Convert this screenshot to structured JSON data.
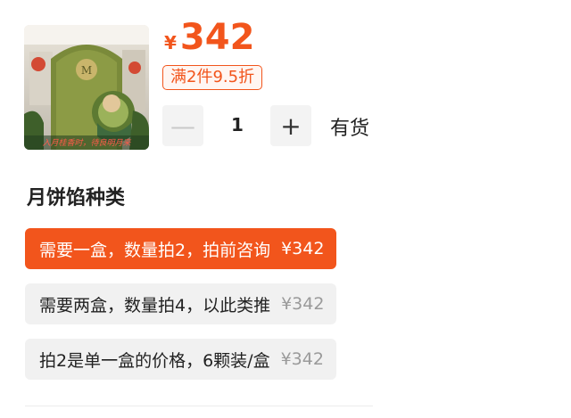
{
  "product": {
    "image_icon": "mooncake-gift-box-image",
    "image_caption": "入月桂香时，待良明月来"
  },
  "price": {
    "currency": "¥",
    "amount": "342"
  },
  "promo_badge": "满2件9.5折",
  "quantity": {
    "minus_label": "—",
    "value": "1",
    "plus_label": "+"
  },
  "stock_status": "有货",
  "section_title": "月饼馅种类",
  "options": [
    {
      "label": "需要一盒，数量拍2，拍前咨询",
      "price": "¥342",
      "selected": true
    },
    {
      "label": "需要两盒，数量拍4，以此类推",
      "price": "¥342",
      "selected": false
    },
    {
      "label": "拍2是单一盒的价格，6颗装/盒",
      "price": "¥342",
      "selected": false
    }
  ],
  "colors": {
    "accent": "#f2551c",
    "option_bg": "#f1f1f1",
    "muted_price": "#9a9a9a"
  }
}
